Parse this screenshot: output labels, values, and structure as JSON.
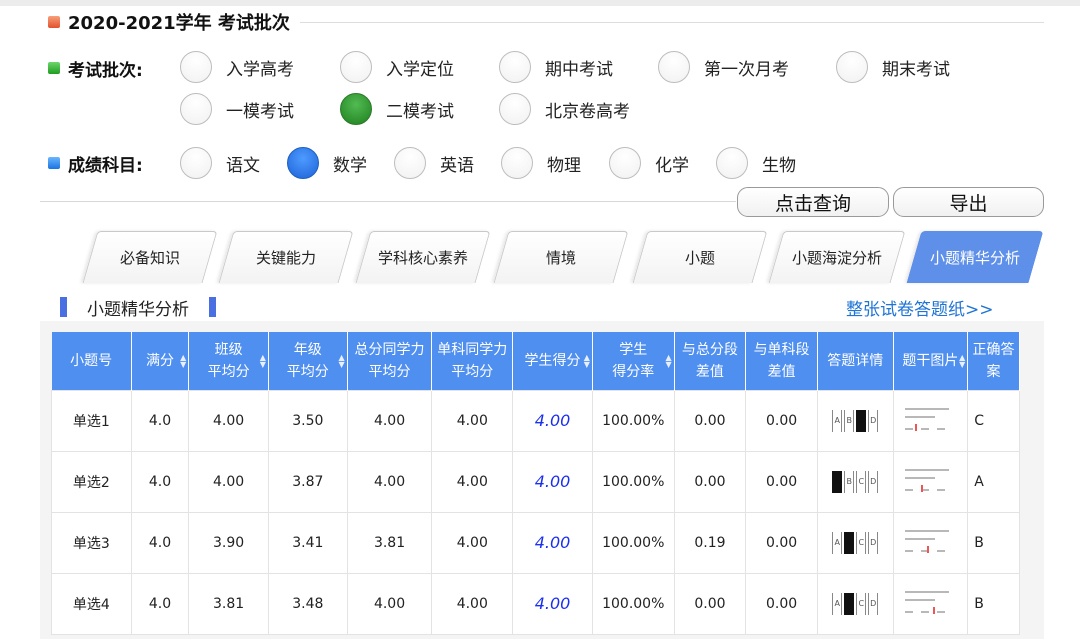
{
  "batch_section": {
    "title": "2020-2021学年 考试批次"
  },
  "exam_batch": {
    "label": "考试批次:",
    "options": [
      "入学高考",
      "入学定位",
      "期中考试",
      "第一次月考",
      "期末考试",
      "一模考试",
      "二模考试",
      "北京卷高考"
    ],
    "selected": "二模考试",
    "selected_color": "#229322"
  },
  "subject": {
    "label": "成绩科目:",
    "options": [
      "语文",
      "数学",
      "英语",
      "物理",
      "化学",
      "生物"
    ],
    "selected": "数学",
    "selected_color": "#1d62d8"
  },
  "buttons": {
    "query": "点击查询",
    "export": "导出"
  },
  "tabs": {
    "items": [
      "必备知识",
      "关键能力",
      "学科核心素养",
      "情境",
      "小题",
      "小题海淀分析",
      "小题精华分析"
    ],
    "active": "小题精华分析",
    "active_color": "#5e8fe9"
  },
  "subsection": {
    "title": "小题精华分析",
    "link": "整张试卷答题纸>>"
  },
  "table": {
    "header_color": "#4f8ff0",
    "columns": [
      {
        "l1": "小题号",
        "l2": "",
        "sort": false
      },
      {
        "l1": "满分",
        "l2": "",
        "sort": true
      },
      {
        "l1": "班级",
        "l2": "平均分",
        "sort": true
      },
      {
        "l1": "年级",
        "l2": "平均分",
        "sort": true
      },
      {
        "l1": "总分同学力",
        "l2": "平均分",
        "sort": false
      },
      {
        "l1": "单科同学力",
        "l2": "平均分",
        "sort": false
      },
      {
        "l1": "学生得分",
        "l2": "",
        "sort": true
      },
      {
        "l1": "学生",
        "l2": "得分率",
        "sort": true
      },
      {
        "l1": "与总分段",
        "l2": "差值",
        "sort": false
      },
      {
        "l1": "与单科段",
        "l2": "差值",
        "sort": false
      },
      {
        "l1": "答题详情",
        "l2": "",
        "sort": false
      },
      {
        "l1": "题干图片",
        "l2": "",
        "sort": true
      },
      {
        "l1": "正确答案",
        "l2": "",
        "sort": false
      }
    ],
    "rows": [
      {
        "q": "单选1",
        "full": "4.0",
        "class_avg": "4.00",
        "grade_avg": "3.50",
        "total_peer": "4.00",
        "subj_peer": "4.00",
        "score": "4.00",
        "rate": "100.00%",
        "diff_total": "0.00",
        "diff_subj": "0.00",
        "detail_opts": [
          "A",
          "B",
          "C",
          "D"
        ],
        "detail_filled": "C",
        "answer": "C"
      },
      {
        "q": "单选2",
        "full": "4.0",
        "class_avg": "4.00",
        "grade_avg": "3.87",
        "total_peer": "4.00",
        "subj_peer": "4.00",
        "score": "4.00",
        "rate": "100.00%",
        "diff_total": "0.00",
        "diff_subj": "0.00",
        "detail_opts": [
          "A",
          "B",
          "C",
          "D"
        ],
        "detail_filled": "A",
        "answer": "A"
      },
      {
        "q": "单选3",
        "full": "4.0",
        "class_avg": "3.90",
        "grade_avg": "3.41",
        "total_peer": "3.81",
        "subj_peer": "4.00",
        "score": "4.00",
        "rate": "100.00%",
        "diff_total": "0.19",
        "diff_subj": "0.00",
        "detail_opts": [
          "A",
          "B",
          "C",
          "D"
        ],
        "detail_filled": "B",
        "answer": "B"
      },
      {
        "q": "单选4",
        "full": "4.0",
        "class_avg": "3.81",
        "grade_avg": "3.48",
        "total_peer": "4.00",
        "subj_peer": "4.00",
        "score": "4.00",
        "rate": "100.00%",
        "diff_total": "0.00",
        "diff_subj": "0.00",
        "detail_opts": [
          "A",
          "B",
          "C",
          "D"
        ],
        "detail_filled": "B",
        "answer": "B"
      }
    ]
  }
}
